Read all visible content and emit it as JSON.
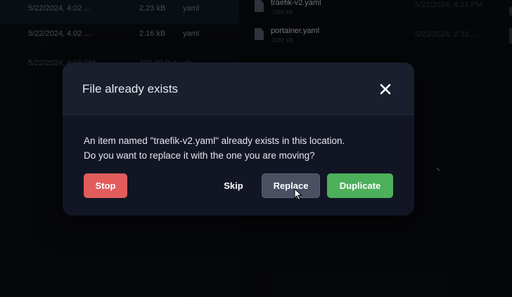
{
  "background": {
    "left_rows": [
      {
        "date": "5/22/2024, 4:02 ...",
        "size": "2.23 kB",
        "type": "yaml"
      },
      {
        "date": "5/22/2024, 4:02 ...",
        "size": "2.16 kB",
        "type": "yaml"
      },
      {
        "date": "5/22/2024, 4:15 PM",
        "size": "320.00 Byt...",
        "type": "sh"
      }
    ],
    "right_files": [
      {
        "name": "traefik-v2.yaml",
        "sub": "1061 kB",
        "date": "5/22/2024, 4:31 PM"
      },
      {
        "name": "portainer.yaml",
        "sub": "1061 kB",
        "date": "5/23/2024, 2:33 ..."
      }
    ]
  },
  "dialog": {
    "title": "File already exists",
    "message_line1": "An item named \"traefik-v2.yaml\" already exists in this location.",
    "message_line2": "Do you want to replace it with the one you are moving?",
    "buttons": {
      "stop": "Stop",
      "skip": "Skip",
      "replace": "Replace",
      "duplicate": "Duplicate"
    },
    "close_icon": "close-icon"
  },
  "colors": {
    "stop": "#e25c5c",
    "replace": "#4a5062",
    "duplicate": "#4cb05a",
    "dialog_bg": "#121624",
    "header_bg": "#1a1f2d"
  }
}
